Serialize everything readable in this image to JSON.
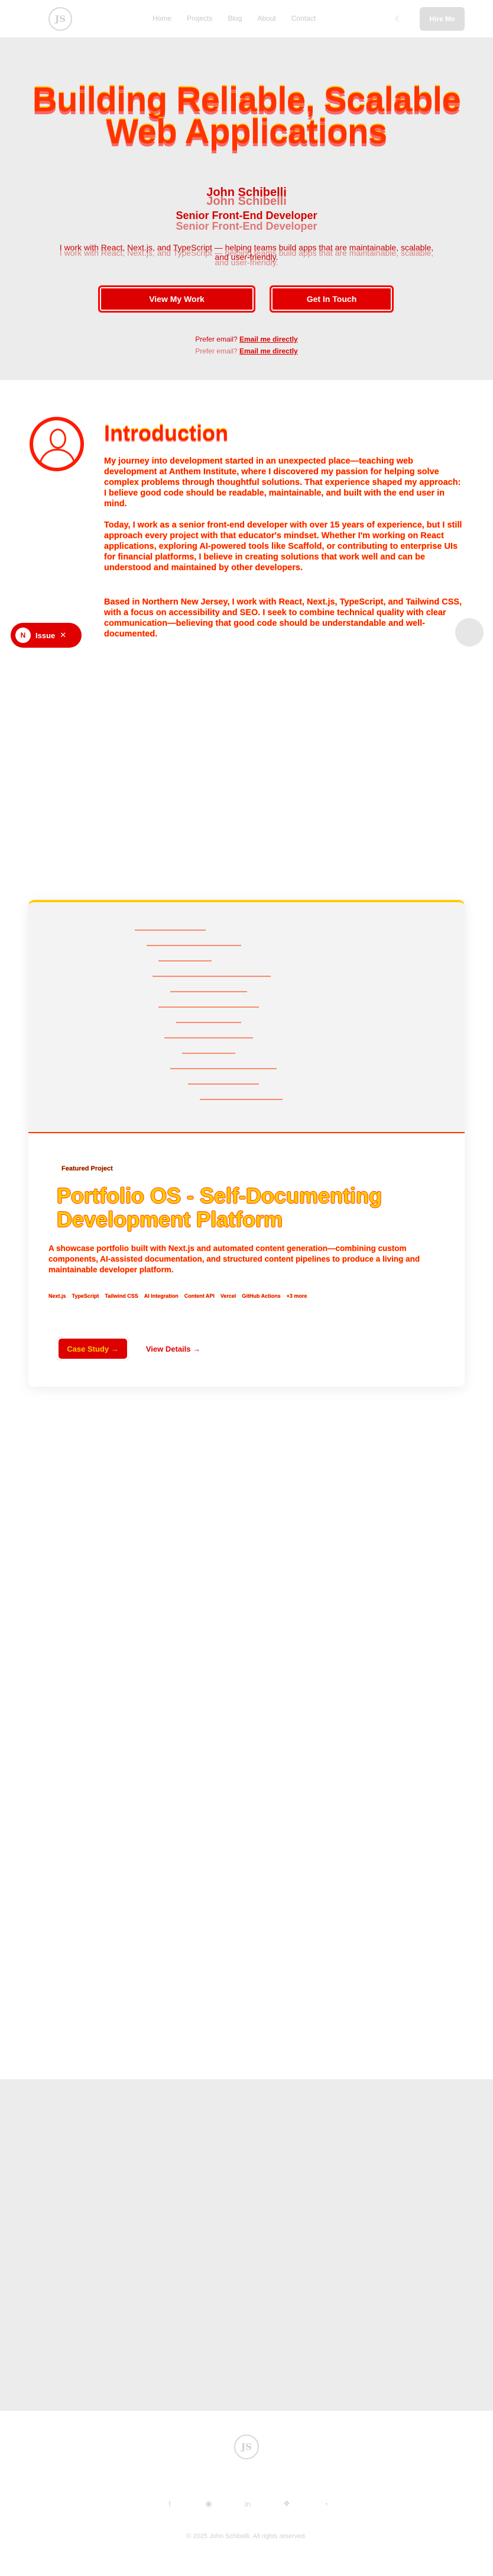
{
  "nav": {
    "logo_text": "JS",
    "links": [
      "Home",
      "Projects",
      "Blog",
      "About",
      "Contact"
    ],
    "theme_icon": "moon-icon",
    "cta_label": "Hire Me"
  },
  "hero": {
    "title_line1": "Building Reliable, Scalable",
    "title_line2": "Web Applications",
    "name": "John Schibelli",
    "role": "Senior Front-End Developer",
    "description": "I work with React, Next.js, and TypeScript — helping teams build apps that are maintainable, scalable, and user-friendly.",
    "primary_button": "View My Work",
    "secondary_button": "Get In Touch",
    "email_prefix": "Prefer email?",
    "email_link": "Email me directly"
  },
  "intro": {
    "title": "Introduction",
    "paragraphs": [
      "My journey into development started in an unexpected place—teaching web development at Anthem Institute, where I discovered my passion for helping solve complex problems through thoughtful solutions. That experience shaped my approach: I believe good code should be readable, maintainable, and built with the end user in mind.",
      "Today, I work as a senior front-end developer with over 15 years of experience, but I still approach every project with that educator's mindset. Whether I'm working on React applications, exploring AI-powered tools like Scaffold, or contributing to enterprise UIs for financial platforms, I believe in creating solutions that work well and can be understood and maintained by other developers.",
      "Based in Northern New Jersey, I work with React, Next.js, TypeScript, and Tailwind CSS, with a focus on accessibility and SEO. I seek to combine technical quality with clear communication—believing that good code should be understandable and well-documented."
    ]
  },
  "floating_chip": {
    "badge": "N",
    "label": "Issue",
    "close_icon": "close-icon"
  },
  "project": {
    "tag": "Featured Project",
    "title": "Portfolio OS - Self-Documenting Development Platform",
    "description": "A showcase portfolio built with Next.js and automated content generation—combining custom components, AI-assisted documentation, and structured content pipelines to produce a living and maintainable developer platform.",
    "tech": [
      "Next.js",
      "TypeScript",
      "Tailwind CSS",
      "AI Integration",
      "Content API",
      "Vercel",
      "GitHub Actions",
      "+3 more"
    ],
    "primary_button": "Case Study →",
    "secondary_button": "View Details →"
  },
  "footer": {
    "logo_text": "JS",
    "icons": [
      "facebook-icon",
      "github-icon",
      "linkedin-icon",
      "bluesky-icon",
      "rss-icon"
    ],
    "copyright": "© 2025 John Schibelli. All rights reserved."
  }
}
